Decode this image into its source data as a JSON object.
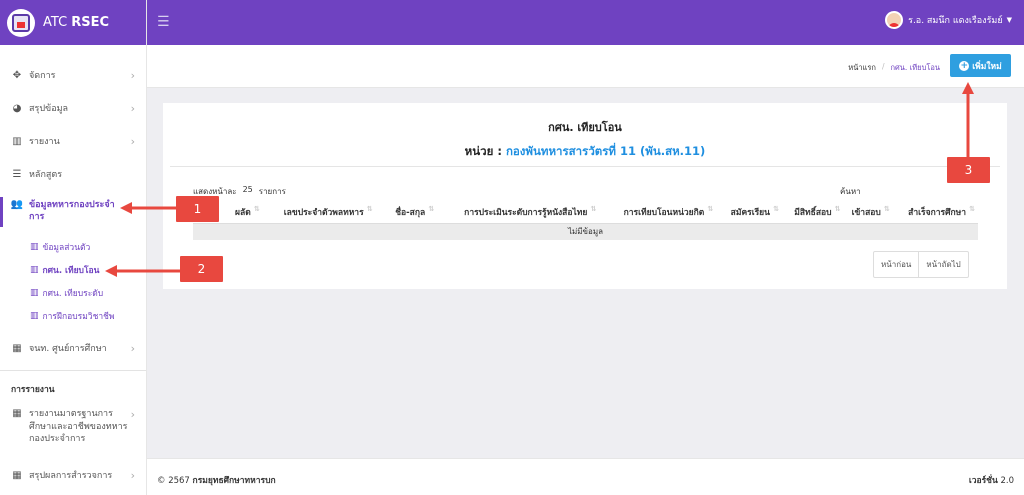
{
  "brand": {
    "prefix": "ATC",
    "name": "RSEC"
  },
  "user": {
    "name": "ร.อ. สมนึก แดงเรืองรัมย์"
  },
  "sidebar": {
    "items": [
      {
        "label": "จัดการ",
        "icon": "move-icon"
      },
      {
        "label": "สรุปข้อมูล",
        "icon": "pie-chart-icon"
      },
      {
        "label": "รายงาน",
        "icon": "bar-chart-icon"
      },
      {
        "label": "หลักสูตร",
        "icon": "list-icon"
      },
      {
        "label_line1": "ข้อมูลทหารกองประจำ",
        "label_line2": "การ",
        "icon": "users-icon"
      },
      {
        "label": "จนท. ศูนย์การศึกษา",
        "icon": "grid-icon"
      }
    ],
    "submenu": [
      {
        "label": "ข้อมูลส่วนตัว"
      },
      {
        "label": "กศน. เทียบโอน"
      },
      {
        "label": "กศน. เทียบระดับ"
      },
      {
        "label": "การฝึกอบรมวิชาชีพ"
      }
    ],
    "report_heading": "การรายงาน",
    "report_items": [
      {
        "line1": "รายงานมาตรฐานการ",
        "line2": "ศึกษาและอาชีพของทหาร",
        "line3": "กองประจำการ"
      },
      {
        "line1": "สรุปผลการสำรวจการ"
      }
    ]
  },
  "breadcrumb": {
    "home": "หน้าแรก",
    "current": "กศน. เทียบโอน"
  },
  "add_button": {
    "label": "เพิ่มใหม่"
  },
  "card": {
    "title": "กศน. เทียบโอน",
    "unit_label": "หน่วย :",
    "unit_value": "กองพันทหารสารวัตรที่ 11 (พัน.สห.11)",
    "length_prefix": "แสดงหน้าละ",
    "length_value": "25",
    "length_suffix": "รายการ",
    "search_label": "ค้นหา"
  },
  "table": {
    "columns": [
      "ผลัด",
      "เลขประจำตัวพลทหาร",
      "ชื่อ-สกุล",
      "การประเมินระดับการรู้หนังสือไทย",
      "การเทียบโอนหน่วยกิต",
      "สมัครเรียน",
      "มีสิทธิ์สอบ",
      "เข้าสอบ",
      "สำเร็จการศึกษา"
    ],
    "empty_message": "ไม่มีข้อมูล"
  },
  "pagination": {
    "prev": "หน้าก่อน",
    "next": "หน้าถัดไป"
  },
  "footer": {
    "copyright": "© 2567",
    "org": "กรมยุทธศึกษาทหารบก",
    "version_label": "เวอร์ชั่น",
    "version": "2.0"
  },
  "callouts": [
    "1",
    "2",
    "3"
  ],
  "colors": {
    "primary": "#6f42c1",
    "accent": "#2f9fe0",
    "callout": "#e8483f",
    "unit_value": "#1f8fe0"
  }
}
